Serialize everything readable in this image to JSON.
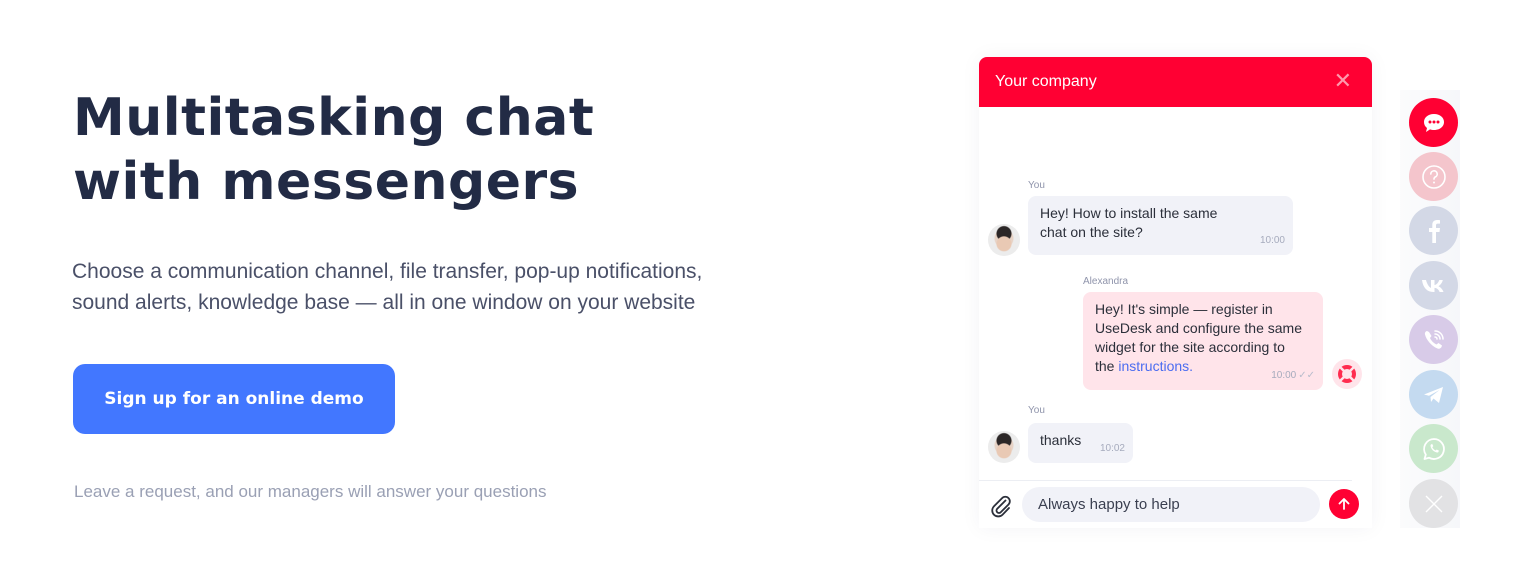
{
  "hero": {
    "title_lines": [
      "Multitasking chat",
      "with messengers"
    ],
    "subtitle_lines": [
      "Choose a communication channel, file transfer, pop-up notifications,",
      "sound alerts, knowledge base — all in one window on your website"
    ],
    "cta_label": "Sign up for an online demo",
    "note": "Leave a request, and our managers will answer your questions"
  },
  "widget": {
    "title": "Your company",
    "close_icon": "close-icon",
    "messages": [
      {
        "author": "You",
        "side": "client",
        "lines": [
          "Hey! How to install the same",
          "chat on the site?"
        ],
        "time": "10:00"
      },
      {
        "author": "Alexandra",
        "side": "agent",
        "lines": [
          "Hey! It's simple — register in",
          "UseDesk and configure the same",
          "widget for the site according to"
        ],
        "last_line_prefix": "the ",
        "link_text": "instructions.",
        "time": "10:00",
        "status_icon": "double-check-icon"
      },
      {
        "author": "You",
        "side": "client",
        "lines": [
          "thanks"
        ],
        "time": "10:02"
      }
    ],
    "composer": {
      "value": "Always happy to help",
      "attach_icon": "paperclip-icon",
      "send_icon": "arrow-up-icon"
    }
  },
  "channels": [
    {
      "name": "chat",
      "icon": "chat-bubble-icon",
      "color": "#ff0033"
    },
    {
      "name": "help",
      "icon": "question-icon",
      "color": "#f4c5cc"
    },
    {
      "name": "facebook",
      "icon": "facebook-icon",
      "color": "#d3d8e6"
    },
    {
      "name": "vk",
      "icon": "vk-icon",
      "color": "#d3d8e6"
    },
    {
      "name": "viber",
      "icon": "viber-icon",
      "color": "#d8cbe8"
    },
    {
      "name": "telegram",
      "icon": "telegram-icon",
      "color": "#c4daf0"
    },
    {
      "name": "whatsapp",
      "icon": "whatsapp-icon",
      "color": "#c9e8cc"
    },
    {
      "name": "close",
      "icon": "close-icon",
      "color": "#e2e2e4"
    }
  ],
  "colors": {
    "brand_red": "#ff0033",
    "cta_blue": "#4277ff",
    "heading": "#222b45"
  }
}
